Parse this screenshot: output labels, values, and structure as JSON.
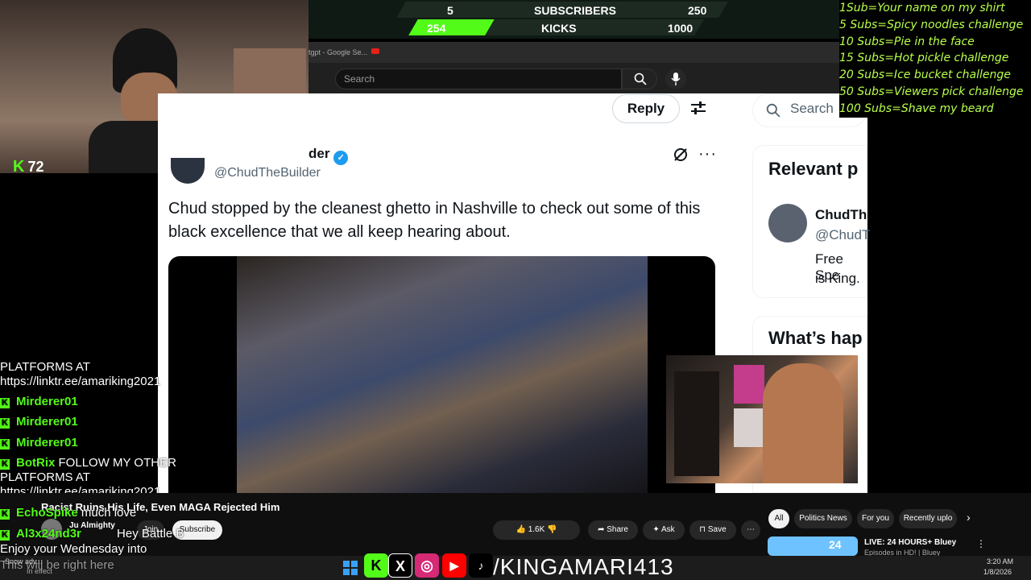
{
  "stats": {
    "subs_current": "5",
    "subs_label": "SUBSCRIBERS",
    "subs_goal": "250",
    "kicks_current": "254",
    "kicks_label": "KICKS",
    "kicks_goal": "1000"
  },
  "browser": {
    "tab_label": "tgpt - Google Se...",
    "search_placeholder": "Search"
  },
  "tweet": {
    "reply_label": "Reply",
    "author_partial": "der",
    "handle_partial": "@ChudTheBuilder",
    "text": "Chud stopped by the cleanest ghetto in Nashville to check out some of this black excellence that we all keep hearing about."
  },
  "sidebar": {
    "search_placeholder": "Search",
    "relevant_title": "Relevant p",
    "relevant_name": "ChudTh",
    "relevant_handle": "@ChudT",
    "relevant_bio_1": "Free Spe",
    "relevant_bio_2": "is King.",
    "happening_title": "What’s hap"
  },
  "kick_viewers": "72",
  "goals": [
    "1Sub=Your name on my shirt",
    "5 Subs=Spicy noodles challenge",
    "10 Subs=Pie in the face",
    "15 Subs=Hot pickle challenge",
    "20 Subs=Ice bucket challenge",
    "50 Subs=Viewers pick challenge",
    "100 Subs=Shave my beard"
  ],
  "chat": {
    "line1": "PLATFORMS AT",
    "line2": "https://linktr.ee/amariking2021",
    "msg1_name": "Mirderer01",
    "msg2_name": "Mirderer01",
    "msg3_name": "Mirderer01",
    "msg4_name": "BotRix",
    "msg4_text": "FOLLOW MY OTHER",
    "msg4_line2": "PLATFORMS AT",
    "msg4_line3": "https://linktr.ee/amariking2021",
    "msg5_name": "EchoSpike",
    "msg5_text": "much love",
    "msg6_name": "Al3x24nd3r",
    "msg6_text": "Hey Battle B",
    "msg7_text": "Enjoy your Wednesday into",
    "msg8_text": "This will be right here"
  },
  "youtube": {
    "video_title": "Racist Ruins His Life, Even MAGA Rejected Him",
    "channel": "Ju Almighty",
    "join_label": "Join",
    "subscribe_label": "Subscribe",
    "likes": "1.6K",
    "share_label": "Share",
    "ask_label": "Ask",
    "save_label": "Save",
    "chips": [
      "All",
      "Politics News",
      "For you",
      "Recently uplo"
    ],
    "live_title": "LIVE: 24 HOURS+ Bluey",
    "live_sub": "Episodes in HD! | Bluey",
    "thumb_badge": "24"
  },
  "taskbar": {
    "handle": "/KINGAMARI413",
    "time": "3:20 AM",
    "date": "1/8/2026",
    "notice_title": "Snow adv...",
    "notice_sub": "In effect"
  },
  "colors": {
    "kick_green": "#53fc18",
    "goal_text": "#b8ff4a",
    "x_blue": "#1d9bf0"
  }
}
